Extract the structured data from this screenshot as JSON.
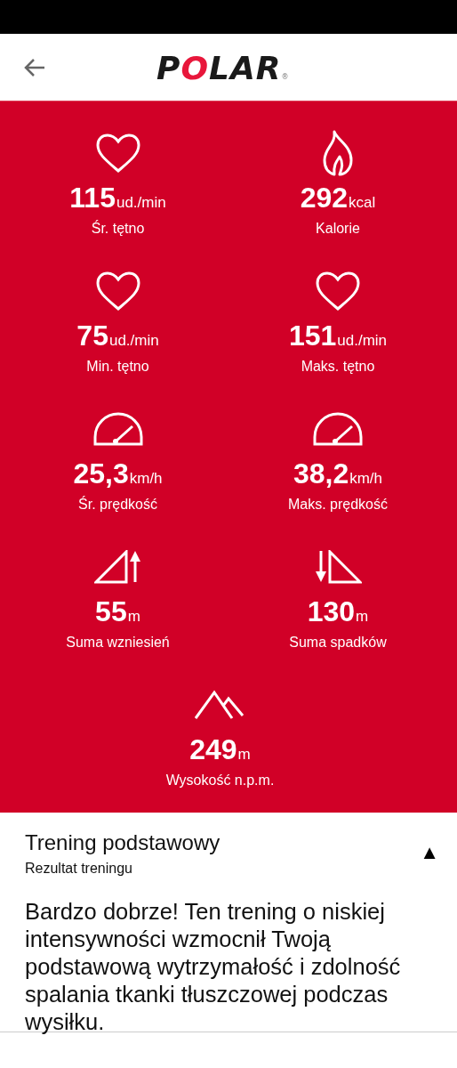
{
  "header": {
    "logo": "POLAR",
    "logo_mark": "®"
  },
  "stats": [
    {
      "kind": "heart",
      "value": "115",
      "unit": "ud./min",
      "label": "Śr. tętno"
    },
    {
      "kind": "flame",
      "value": "292",
      "unit": "kcal",
      "label": "Kalorie"
    },
    {
      "kind": "heart",
      "value": "75",
      "unit": "ud./min",
      "label": "Min. tętno"
    },
    {
      "kind": "heart",
      "value": "151",
      "unit": "ud./min",
      "label": "Maks. tętno"
    },
    {
      "kind": "speedometer",
      "value": "25,3",
      "unit": "km/h",
      "label": "Śr. prędkość"
    },
    {
      "kind": "speedometer",
      "value": "38,2",
      "unit": "km/h",
      "label": "Maks. prędkość"
    },
    {
      "kind": "ascent",
      "value": "55",
      "unit": "m",
      "label": "Suma wzniesień"
    },
    {
      "kind": "descent",
      "value": "130",
      "unit": "m",
      "label": "Suma spadków"
    },
    {
      "kind": "mountain",
      "value": "249",
      "unit": "m",
      "label": "Wysokość n.p.m."
    }
  ],
  "result": {
    "title": "Trening podstawowy",
    "subtitle": "Rezultat treningu",
    "toggle": "▲",
    "expanded": true,
    "text": "Bardzo dobrze! Ten trening o niskiej intensywności wzmocnił Twoją podstawową wytrzymałość i zdolność spalania tkanki tłuszczowej podczas wysiłku."
  }
}
